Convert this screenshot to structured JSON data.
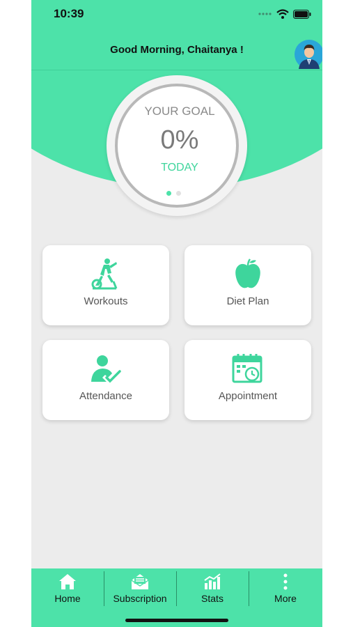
{
  "status": {
    "time": "10:39"
  },
  "header": {
    "greeting": "Good Morning, Chaitanya !"
  },
  "goal": {
    "title": "YOUR GOAL",
    "value": "0%",
    "period": "TODAY",
    "progress": 0,
    "active_page": 1,
    "pages": 2
  },
  "cards": [
    {
      "label": "Workouts",
      "icon": "exercise-bike-icon"
    },
    {
      "label": "Diet Plan",
      "icon": "apple-icon"
    },
    {
      "label": "Attendance",
      "icon": "attendance-check-icon"
    },
    {
      "label": "Appointment",
      "icon": "calendar-clock-icon"
    }
  ],
  "tabbar": {
    "items": [
      {
        "label": "Home",
        "icon": "home-icon"
      },
      {
        "label": "Subscription",
        "icon": "envelope-icon"
      },
      {
        "label": "Stats",
        "icon": "bar-chart-icon"
      },
      {
        "label": "More",
        "icon": "more-vertical-icon"
      }
    ]
  },
  "colors": {
    "accent": "#4de2a9",
    "background": "#ececec",
    "card": "#ffffff",
    "accent_text": "#3ed59c"
  }
}
